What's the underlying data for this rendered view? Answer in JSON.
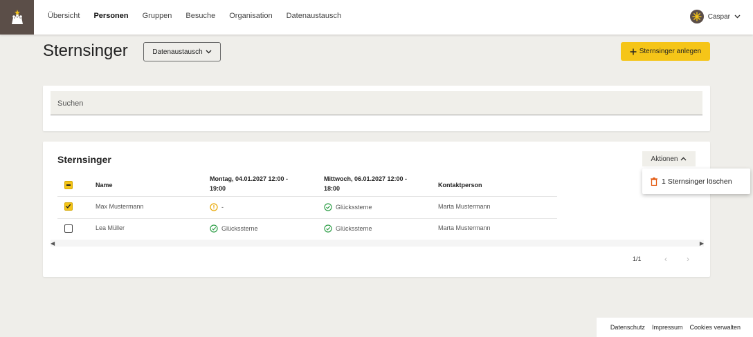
{
  "nav": {
    "items": [
      "Übersicht",
      "Personen",
      "Gruppen",
      "Besuche",
      "Organisation",
      "Datenaustausch"
    ],
    "active_index": 1
  },
  "user": {
    "name": "Caspar"
  },
  "header": {
    "title": "Sternsinger",
    "dropdown_label": "Datenaustausch",
    "add_label": "Sternsinger anlegen",
    "accent_color": "#f5c518"
  },
  "search": {
    "placeholder": "Suchen"
  },
  "table": {
    "title": "Sternsinger",
    "actions_label": "Aktionen",
    "menu_item": "1 Sternsinger löschen",
    "columns": {
      "name": "Name",
      "date1_line1": "Montag, 04.01.2027 12:00 -",
      "date1_line2": "19:00",
      "date2_line1": "Mittwoch, 06.01.2027 12:00 -",
      "date2_line2": "18:00",
      "contact": "Kontaktperson"
    },
    "rows": [
      {
        "checked": true,
        "name": "Max Mustermann",
        "date1_icon": "warning-circle-icon",
        "date1": "-",
        "date2_icon": "check-circle-icon",
        "date2": "Glückssterne",
        "contact": "Marta Mustermann"
      },
      {
        "checked": false,
        "name": "Lea Müller",
        "date1_icon": "check-circle-icon",
        "date1": "Glückssterne",
        "date2_icon": "check-circle-icon",
        "date2": "Glückssterne",
        "contact": "Marta Mustermann"
      }
    ],
    "pagination": "1/1"
  },
  "footer": {
    "privacy": "Datenschutz",
    "imprint": "Impressum",
    "cookies": "Cookies verwalten"
  }
}
